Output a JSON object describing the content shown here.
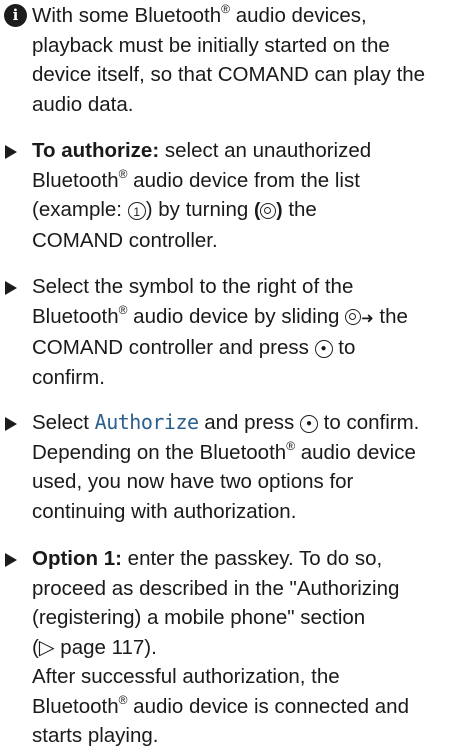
{
  "note": {
    "lines": [
      "With some Bluetooth",
      "playback must be initially started on the",
      "device itself, so that COMAND can play the",
      "audio data."
    ],
    "after_sup": " audio devices,",
    "sup": "®"
  },
  "steps": [
    {
      "bold": "To authorize:",
      "l1": " select an unauthorized",
      "l2a": "Bluetooth",
      "l2b": " audio device from the list",
      "l3a": "(example: ",
      "l3b": ") by turning ",
      "l3c": " the",
      "l4": "COMAND controller.",
      "callout": "1"
    },
    {
      "l1": "Select the symbol to the right of the",
      "l2a": "Bluetooth",
      "l2b": " audio device by sliding ",
      "l2c": " the",
      "l3a": "COMAND controller and press ",
      "l3b": " to",
      "l4": "confirm."
    },
    {
      "l1a": "Select ",
      "l1menu": "Authorize",
      "l1b": " and press ",
      "l1c": " to confirm.",
      "l2a": "Depending on the Bluetooth",
      "l2b": " audio device",
      "l3": "used, you now have two options for",
      "l4": "continuing with authorization."
    },
    {
      "bold": "Option 1:",
      "l1": " enter the passkey. To do so,",
      "l2": "proceed as described in the \"Authorizing",
      "l3": "(registering) a mobile phone\" section",
      "l4": "(▷ page 117).",
      "l5": "After successful authorization, the",
      "l6a": "Bluetooth",
      "l6b": " audio device is connected and",
      "l7": "starts playing."
    }
  ],
  "sup": "®",
  "icons": {
    "info": "info-icon",
    "bullet": "arrow-bullet-icon",
    "turn": "controller-turn-icon",
    "slide": "controller-slide-right-icon",
    "press": "controller-press-icon"
  }
}
